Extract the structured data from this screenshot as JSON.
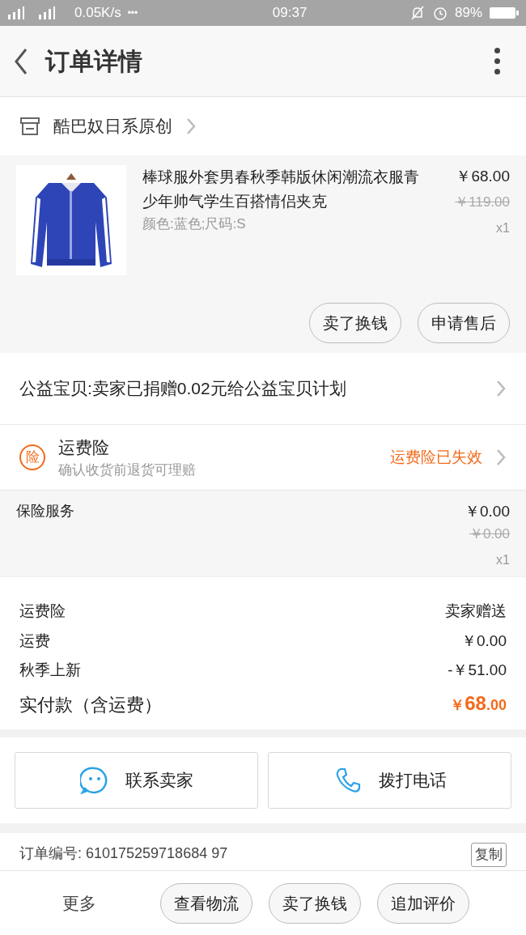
{
  "status_bar": {
    "network": "0.05K/s",
    "dots": "•••",
    "time": "09:37",
    "battery_percent": "89%"
  },
  "header": {
    "title": "订单详情"
  },
  "shop": {
    "name": "酷巴奴日系原创"
  },
  "product": {
    "title": "棒球服外套男春秋季韩版休闲潮流衣服青少年帅气学生百搭情侣夹克",
    "variant": "颜色:蓝色;尺码:S",
    "price": "￥68.00",
    "original_price": "￥119.00",
    "quantity": "x1",
    "image": {
      "kind": "picture"
    },
    "buttons": [
      "卖了换钱",
      "申请售后"
    ]
  },
  "charity": {
    "text": "公益宝贝:卖家已捐赠0.02元给公益宝贝计划"
  },
  "insurance": {
    "badge": "险",
    "title": "运费险",
    "subtitle": "确认收货前退货可理赔",
    "status": "运费险已失效"
  },
  "insurance_service": {
    "name": "保险服务",
    "price": "￥0.00",
    "original_price": "￥0.00",
    "quantity": "x1"
  },
  "summary": {
    "rows": [
      {
        "label": "运费险",
        "value": "卖家赠送"
      },
      {
        "label": "运费",
        "value": "￥0.00"
      },
      {
        "label": "秋季上新",
        "value": "-￥51.00"
      }
    ],
    "total_label": "实付款（含运费）",
    "total_currency": "￥",
    "total_integer": "68",
    "total_decimal": ".00"
  },
  "contact": [
    {
      "kind": "chat",
      "label": "联系卖家"
    },
    {
      "kind": "phone",
      "label": "拨打电话"
    }
  ],
  "order": {
    "number": "订单编号: 610175259718684 97",
    "copy": "复制"
  },
  "bottom_bar": {
    "more": "更多",
    "buttons": [
      "查看物流",
      "卖了换钱",
      "追加评价"
    ]
  }
}
